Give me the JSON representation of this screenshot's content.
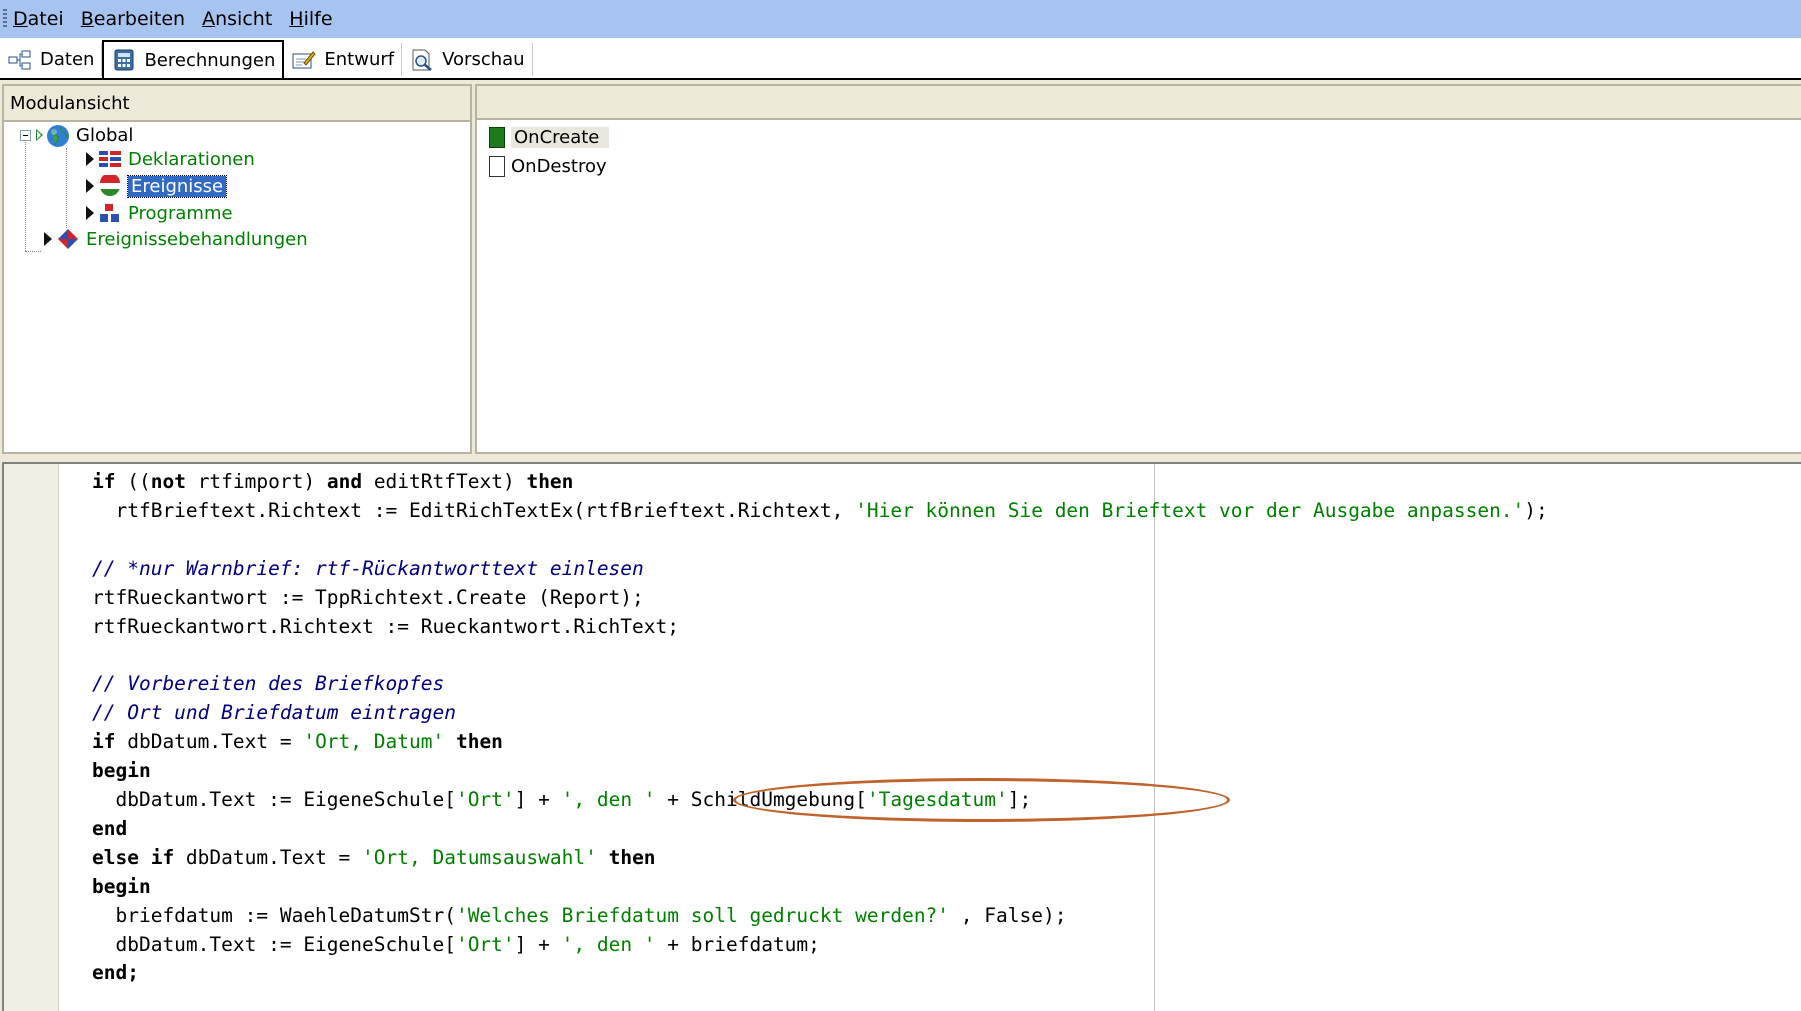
{
  "menu": {
    "items": [
      {
        "accel": "D",
        "rest": "atei"
      },
      {
        "accel": "B",
        "rest": "earbeiten"
      },
      {
        "accel": "A",
        "rest": "nsicht"
      },
      {
        "accel": "H",
        "rest": "ilfe"
      }
    ]
  },
  "toolbar": {
    "tabs": [
      {
        "label": "Daten",
        "icon": "data-structure-icon",
        "active": false
      },
      {
        "label": "Berechnungen",
        "icon": "calculator-icon",
        "active": true
      },
      {
        "label": "Entwurf",
        "icon": "design-edit-icon",
        "active": false
      },
      {
        "label": "Vorschau",
        "icon": "preview-magnifier-icon",
        "active": false
      }
    ]
  },
  "module_view": {
    "title": "Modulansicht",
    "tree": {
      "root": "Global",
      "children": [
        "Deklarationen",
        "Ereignisse",
        "Programme"
      ],
      "sibling": "Ereignissebehandlungen",
      "selected": "Ereignisse"
    }
  },
  "events_list": {
    "items": [
      "OnCreate",
      "OnDestroy"
    ],
    "selected": "OnCreate"
  },
  "code": {
    "l1_kw1": "if",
    "l1_t1": " ((",
    "l1_kw2": "not",
    "l1_t2": " rtfimport) ",
    "l1_kw3": "and",
    "l1_t3": " editRtfText) ",
    "l1_kw4": "then",
    "l2_t1": "  rtfBrieftext.Richtext := EditRichTextEx(rtfBrieftext.Richtext, ",
    "l2_str": "'Hier können Sie den Brieftext vor der Ausgabe anpassen.'",
    "l2_t2": ");",
    "l4_cmt": "// *nur Warnbrief: rtf-Rückantworttext einlesen",
    "l5": "rtfRueckantwort := TppRichtext.Create (Report);",
    "l6": "rtfRueckantwort.Richtext := Rueckantwort.RichText;",
    "l8_cmt": "// Vorbereiten des Briefkopfes",
    "l9_cmt": "// Ort und Briefdatum eintragen",
    "l10_kw1": "if",
    "l10_t1": " dbDatum.Text = ",
    "l10_str": "'Ort, Datum'",
    "l10_kw2": " then",
    "l11_kw": "begin",
    "l12_t1": "  dbDatum.Text := EigeneSchule[",
    "l12_s1": "'Ort'",
    "l12_t2": "] + ",
    "l12_s2": "', den '",
    "l12_t3": " + SchildUmgebung[",
    "l12_s3": "'Tagesdatum'",
    "l12_t4": "];",
    "l13_kw": "end",
    "l14_kw1": "else if",
    "l14_t1": " dbDatum.Text = ",
    "l14_str": "'Ort, Datumsauswahl'",
    "l14_kw2": " then",
    "l15_kw": "begin",
    "l16_t1": "  briefdatum := WaehleDatumStr(",
    "l16_str": "'Welches Briefdatum soll gedruckt werden?'",
    "l16_t2": " , False);",
    "l17_t1": "  dbDatum.Text := EigeneSchule[",
    "l17_s1": "'Ort'",
    "l17_t2": "] + ",
    "l17_s2": "', den '",
    "l17_t3": " + briefdatum;",
    "l18_kw": "end;"
  },
  "colors": {
    "menubar": "#a7c3ef",
    "keyword_green": "#008000",
    "comment_blue": "#000080",
    "selection_blue": "#316ac5",
    "annotation_orange": "#c0622b"
  }
}
